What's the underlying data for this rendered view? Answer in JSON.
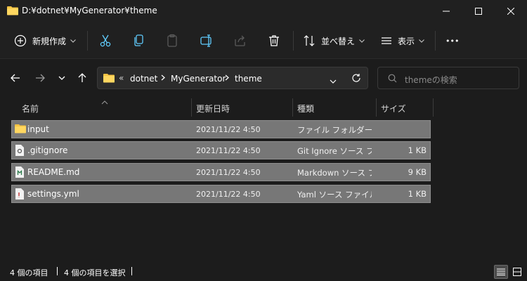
{
  "titlebar": {
    "title": "D:¥dotnet¥MyGenerator¥theme"
  },
  "commandbar": {
    "new_label": "新規作成",
    "sort_label": "並べ替え",
    "view_label": "表示",
    "more_label": "•••"
  },
  "address": {
    "overflow": "«",
    "crumbs": [
      "dotnet",
      "MyGenerator",
      "theme"
    ]
  },
  "search": {
    "placeholder": "themeの検索"
  },
  "columns": {
    "name": "名前",
    "date": "更新日時",
    "type": "種類",
    "size": "サイズ"
  },
  "files": [
    {
      "name": "input",
      "date": "2021/11/22 4:50",
      "type": "ファイル フォルダー",
      "size": "",
      "icon": "folder-icon"
    },
    {
      "name": ".gitignore",
      "date": "2021/11/22 4:50",
      "type": "Git Ignore ソース ファイル",
      "size": "1 KB",
      "icon": "git-file-icon"
    },
    {
      "name": "README.md",
      "date": "2021/11/22 4:50",
      "type": "Markdown ソース ファイル",
      "size": "9 KB",
      "icon": "markdown-file-icon"
    },
    {
      "name": "settings.yml",
      "date": "2021/11/22 4:50",
      "type": "Yaml ソース ファイル",
      "size": "1 KB",
      "icon": "yaml-file-icon"
    }
  ],
  "statusbar": {
    "count": "4 個の項目",
    "selected": "4 個の項目を選択"
  },
  "colors": {
    "accent": "#60cdff",
    "folder": "#f5c344",
    "selection": "#777777"
  }
}
